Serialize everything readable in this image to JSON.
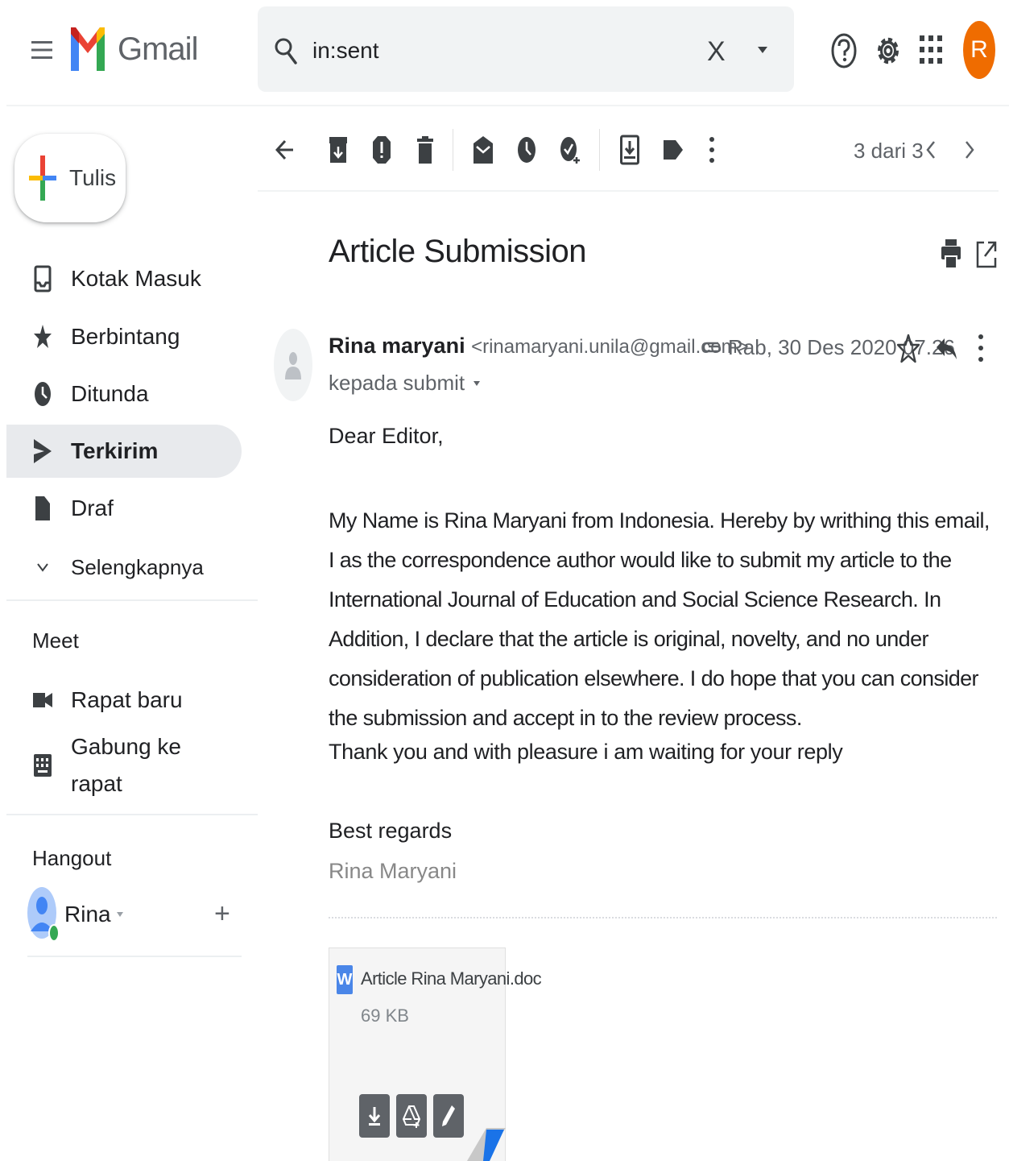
{
  "app": {
    "name": "Gmail",
    "avatar_letter": "R"
  },
  "search": {
    "value": "in:sent",
    "clear_label": "X"
  },
  "sidebar": {
    "compose_label": "Tulis",
    "items": [
      {
        "label": "Kotak Masuk",
        "icon": "inbox-icon"
      },
      {
        "label": "Berbintang",
        "icon": "star-icon"
      },
      {
        "label": "Ditunda",
        "icon": "clock-icon"
      },
      {
        "label": "Terkirim",
        "icon": "send-icon",
        "active": true
      },
      {
        "label": "Draf",
        "icon": "draft-icon"
      },
      {
        "label": "Selengkapnya",
        "icon": "chevron-down-icon"
      }
    ],
    "meet": {
      "heading": "Meet",
      "new_meeting": "Rapat baru",
      "join_line1": "Gabung ke",
      "join_line2": "rapat"
    },
    "hangout": {
      "heading": "Hangout",
      "user": "Rina",
      "add_label": "+"
    }
  },
  "toolbar": {
    "pager": "3 dari 3"
  },
  "message": {
    "subject": "Article Submission",
    "sender_name": "Rina maryani",
    "sender_email": "<rinamaryani.unila@gmail.com>",
    "recipient": "kepada submit",
    "date": "Rab, 30 Des 2020 07.26",
    "greeting": "Dear Editor,",
    "paragraph": "My Name is Rina Maryani from Indonesia. Hereby by writhing this email, I as the correspondence author would like to submit my article to the International Journal of Education and Social Science Research. In Addition, I declare that the article is original, novelty, and no under consideration of publication elsewhere. I do  hope that you can consider the submission and accept in to the review process.",
    "thanks": "Thank you and with pleasure i am waiting for your reply",
    "regards": "Best regards",
    "signature": "Rina Maryani"
  },
  "attachment": {
    "type_letter": "W",
    "name": "Article Rina Maryani.doc",
    "size": "69 KB"
  },
  "colors": {
    "avatar": "#ef6c00",
    "active_nav": "#e8eaed",
    "search_bg": "#f1f3f4",
    "doc_icon": "#4a86e8"
  }
}
